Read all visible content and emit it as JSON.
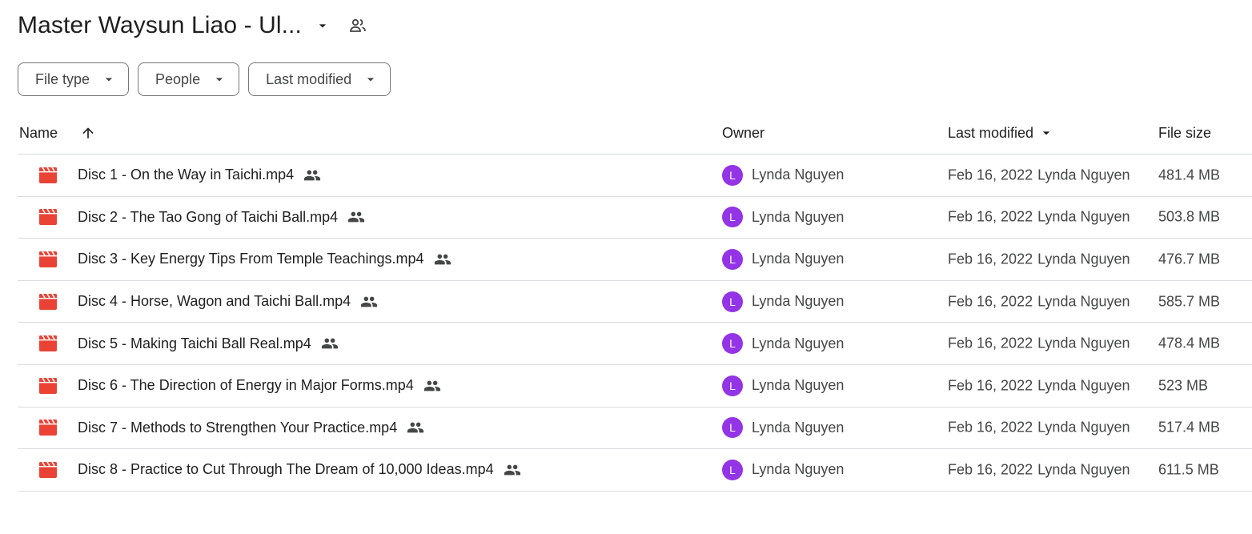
{
  "header": {
    "title": "Master Waysun Liao - Ul...",
    "title_caret_icon": "arrow-drop-down-icon",
    "shared_icon": "people-icon"
  },
  "filters": [
    {
      "label": "File type"
    },
    {
      "label": "People"
    },
    {
      "label": "Last modified"
    }
  ],
  "columns": {
    "name": "Name",
    "owner": "Owner",
    "last_modified": "Last modified",
    "file_size": "File size"
  },
  "colors": {
    "file_icon": "#ea4335",
    "avatar_bg": "#9334e6",
    "divider": "#dadce0"
  },
  "files": [
    {
      "name": "Disc 1 - On the Way in Taichi.mp4",
      "owner": "Lynda Nguyen",
      "owner_initial": "L",
      "modified_date": "Feb 16, 2022",
      "modified_by": "Lynda Nguyen",
      "size": "481.4 MB"
    },
    {
      "name": "Disc 2 - The Tao Gong of Taichi Ball.mp4",
      "owner": "Lynda Nguyen",
      "owner_initial": "L",
      "modified_date": "Feb 16, 2022",
      "modified_by": "Lynda Nguyen",
      "size": "503.8 MB"
    },
    {
      "name": "Disc 3 - Key Energy Tips From Temple Teachings.mp4",
      "owner": "Lynda Nguyen",
      "owner_initial": "L",
      "modified_date": "Feb 16, 2022",
      "modified_by": "Lynda Nguyen",
      "size": "476.7 MB"
    },
    {
      "name": "Disc 4 - Horse, Wagon and Taichi Ball.mp4",
      "owner": "Lynda Nguyen",
      "owner_initial": "L",
      "modified_date": "Feb 16, 2022",
      "modified_by": "Lynda Nguyen",
      "size": "585.7 MB"
    },
    {
      "name": "Disc 5 - Making Taichi Ball Real.mp4",
      "owner": "Lynda Nguyen",
      "owner_initial": "L",
      "modified_date": "Feb 16, 2022",
      "modified_by": "Lynda Nguyen",
      "size": "478.4 MB"
    },
    {
      "name": "Disc 6 - The Direction of Energy in Major Forms.mp4",
      "owner": "Lynda Nguyen",
      "owner_initial": "L",
      "modified_date": "Feb 16, 2022",
      "modified_by": "Lynda Nguyen",
      "size": "523 MB"
    },
    {
      "name": "Disc 7 - Methods to Strengthen Your Practice.mp4",
      "owner": "Lynda Nguyen",
      "owner_initial": "L",
      "modified_date": "Feb 16, 2022",
      "modified_by": "Lynda Nguyen",
      "size": "517.4 MB"
    },
    {
      "name": "Disc 8 - Practice to Cut Through The Dream of 10,000 Ideas.mp4",
      "owner": "Lynda Nguyen",
      "owner_initial": "L",
      "modified_date": "Feb 16, 2022",
      "modified_by": "Lynda Nguyen",
      "size": "611.5 MB"
    }
  ]
}
